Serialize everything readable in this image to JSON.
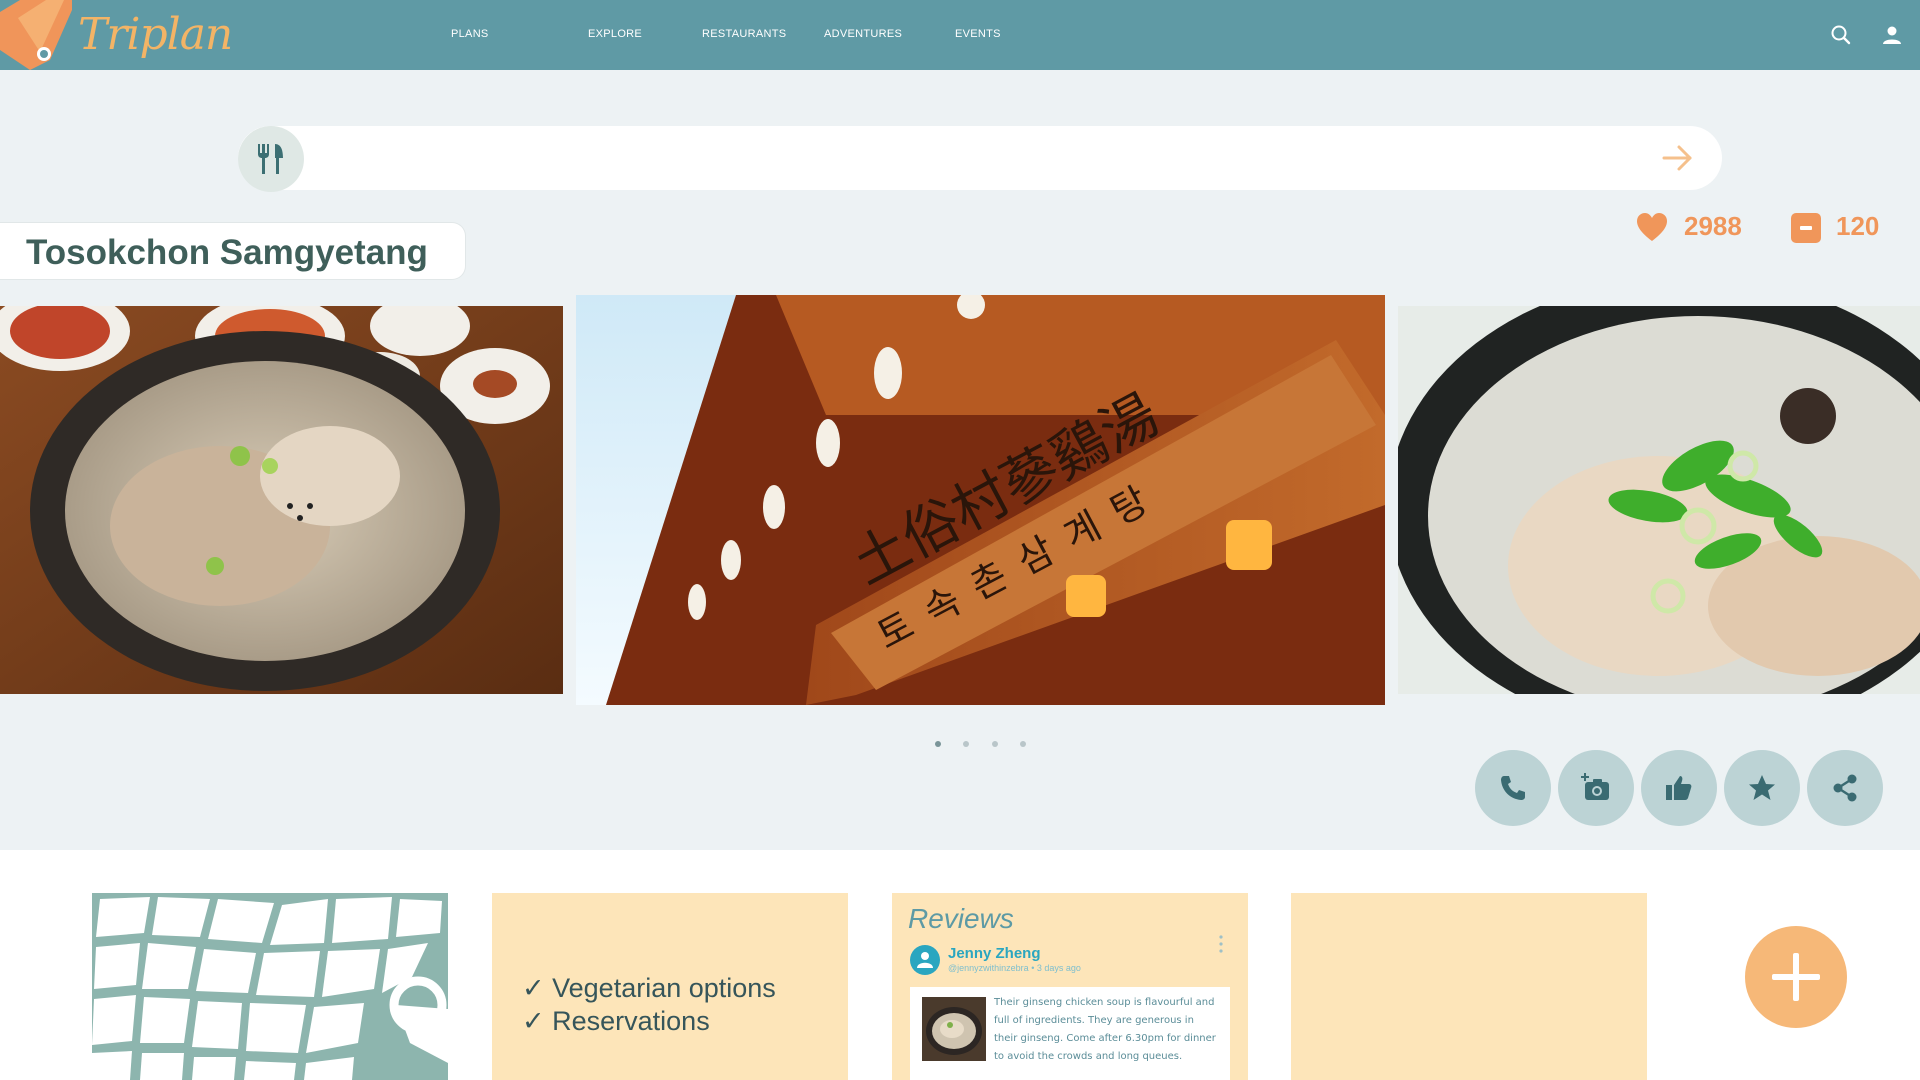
{
  "app": {
    "logo_text": "Triplan"
  },
  "nav": {
    "items": [
      {
        "label": "PLANS"
      },
      {
        "label": "EXPLORE"
      },
      {
        "label": "RESTAURANTS"
      },
      {
        "label": "ADVENTURES"
      },
      {
        "label": "EVENTS"
      }
    ],
    "icons": [
      "search-icon",
      "user-icon"
    ]
  },
  "search": {
    "value": "",
    "placeholder": "",
    "category_icon": "fork-knife-icon",
    "submit_icon": "arrow-right-icon"
  },
  "place": {
    "name": "Tosokchon Samgyetang",
    "likes": "2988",
    "comments": "120"
  },
  "carousel": {
    "photos": [
      "samgyetang-bowl-with-side-dishes",
      "restaurant-signboard",
      "ginseng-chicken-soup-closeup"
    ],
    "sign_text": {
      "hanja": "土俗村蔘鷄湯",
      "hangul": "토속촌삼계탕"
    },
    "active_index": 0,
    "dot_count": 4
  },
  "actions": [
    "phone-icon",
    "add-photo-icon",
    "thumbs-up-icon",
    "star-icon",
    "share-icon"
  ],
  "amenities": [
    "✓ Vegetarian options",
    "✓ Reservations"
  ],
  "reviews": {
    "title": "Reviews",
    "items": [
      {
        "author": "Jenny Zheng",
        "handle": "@jennyzwithinzebra",
        "time": "3 days ago",
        "text": "Their ginseng chicken soup is flavourful and full of ingredients. They are generous in their ginseng. Come after 6.30pm for dinner to avoid the crowds and long queues."
      }
    ]
  },
  "colors": {
    "topbar": "#5f9aa5",
    "accent_orange": "#f0965a",
    "card_bg": "#fde5b9",
    "action_btn": "#bcd3d5",
    "fab": "#f6b878"
  }
}
